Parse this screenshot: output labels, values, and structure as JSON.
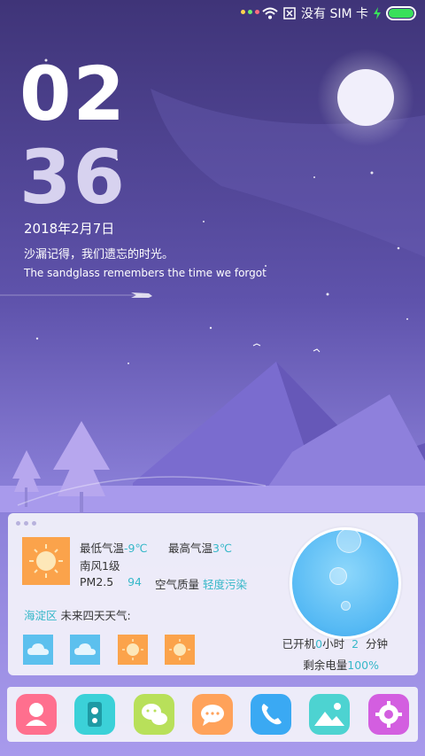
{
  "status_bar": {
    "carrier": "没有 SIM 卡",
    "notification_dots": [
      "#ffd54d",
      "#6ef06e",
      "#ff6d7e"
    ],
    "icons": [
      "wifi-icon",
      "no-sim-icon",
      "charging-icon",
      "battery-icon"
    ],
    "battery_level": 1.0
  },
  "lockscreen": {
    "hour": "02",
    "minute": "36",
    "date": "2018年2月7日",
    "quote_cn": "沙漏记得，我们遗忘的时光。",
    "quote_en": "The sandglass remembers the time we forgot"
  },
  "weather": {
    "low_label": "最低气温",
    "low_value": "-9℃",
    "high_label": "最高气温",
    "high_value": "3℃",
    "wind": "南风1级",
    "pm_label": "PM2.5",
    "pm_value": "94",
    "aq_label": "空气质量",
    "aq_value": "轻度污染",
    "district": "海淀区",
    "forecast_label": "未来四天天气:",
    "forecast": [
      "cloudy",
      "cloudy",
      "sunny",
      "sunny"
    ],
    "uptime_prefix": "已开机",
    "uptime_hours": "0",
    "uptime_hours_unit": "小时",
    "uptime_minutes": "2",
    "uptime_minutes_unit": "分钟",
    "battery_label": "剩余电量",
    "battery_value": "100%"
  },
  "dock": {
    "apps": [
      {
        "name": "contacts-app",
        "color": "#ff6f8e"
      },
      {
        "name": "camera-app",
        "color": "#3bd1d8"
      },
      {
        "name": "wechat-app",
        "color": "#b8e05a"
      },
      {
        "name": "messages-app",
        "color": "#ffa25a"
      },
      {
        "name": "phone-app",
        "color": "#3aa9f3"
      },
      {
        "name": "gallery-app",
        "color": "#4dd3d1"
      },
      {
        "name": "settings-app",
        "color": "#d35ee0"
      }
    ]
  },
  "colors": {
    "sky_top": "#3f3478",
    "sky_bottom": "#8a7fd8",
    "mountain": "#7a6ccf",
    "accent_teal": "#37b8c9"
  }
}
